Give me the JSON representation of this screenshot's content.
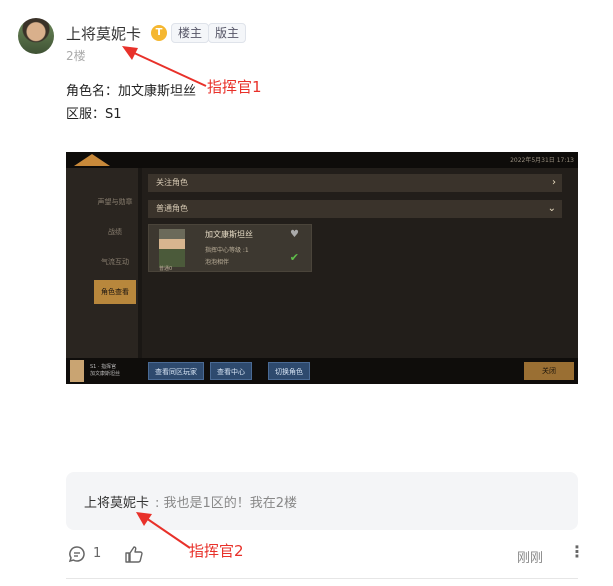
{
  "post": {
    "username": "上将莫妮卡",
    "vip_badge": "T",
    "tags": [
      "楼主",
      "版主"
    ],
    "floor": "2楼",
    "lines": [
      "角色名：加文康斯坦丝",
      "区服：S1"
    ]
  },
  "annotations": {
    "first": "指挥官1",
    "second": "指挥官2"
  },
  "game": {
    "datetime": "2022年5月31日  17:13",
    "side_items": [
      "声望与勋章",
      "战绩",
      "气流互动",
      "角色查看"
    ],
    "active_side": "角色查看",
    "bars": [
      "关注角色",
      "普通角色"
    ],
    "card": {
      "name": "加文康斯坦丝",
      "line1": "指挥中心等级 :1",
      "line2": "泡泡相伴",
      "badge": "普通0"
    },
    "bottom_player": {
      "line1": "S1 · 指挥官",
      "line2": "加文康斯坦丝"
    },
    "buttons": [
      "查看同区玩家",
      "查看中心",
      "切换角色"
    ],
    "gold_button": "关闭"
  },
  "reply": {
    "user": "上将莫妮卡",
    "text": ": 我也是1区的！我在2楼"
  },
  "footer": {
    "comment_count": "1",
    "time": "刚刚",
    "more": "⋮"
  },
  "colors": {
    "annotation": "#e8312a",
    "accent_gold": "#b8873c"
  }
}
